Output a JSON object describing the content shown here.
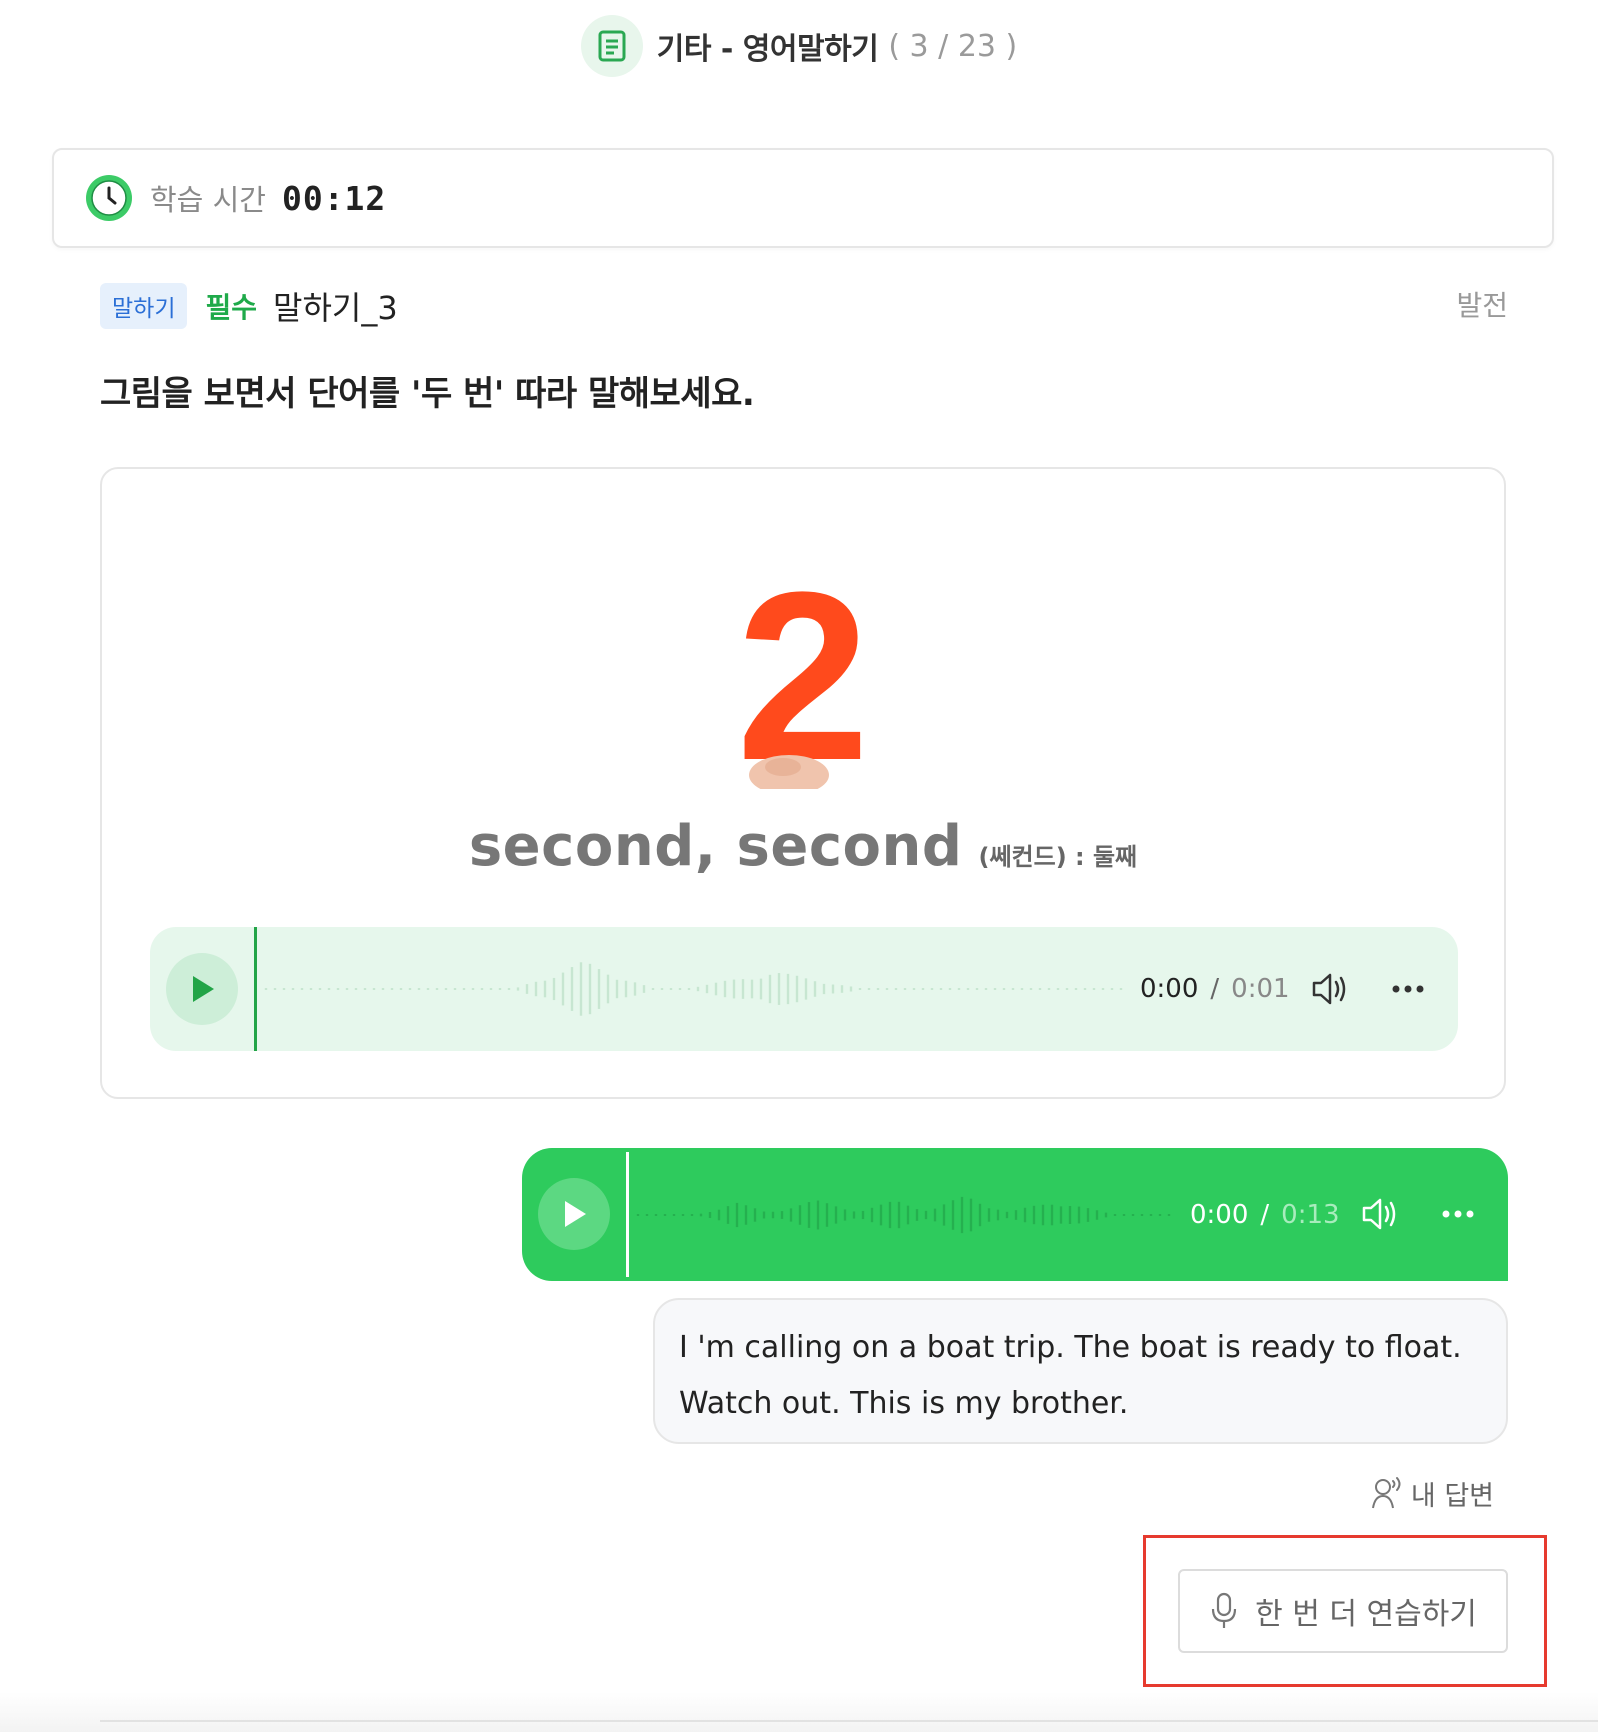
{
  "header": {
    "title": "기타 - 영어말하기",
    "count": "( 3 / 23 )",
    "icon": "document-icon"
  },
  "timer": {
    "label": "학습 시간",
    "value": "00:12",
    "icon": "clock-icon"
  },
  "question": {
    "tag": "말하기",
    "required": "필수",
    "name": "말하기_3",
    "level": "발전",
    "instruction": "그림을 보면서 단어를 '두 번' 따라 말해보세요."
  },
  "card": {
    "image_text": "2",
    "word": "second, second",
    "pronunciation": "(쎄컨드) : 둘째",
    "audio": {
      "current": "0:00",
      "separator": "/",
      "total": "0:01"
    }
  },
  "answer_audio": {
    "current": "0:00",
    "separator": "/",
    "total": "0:13"
  },
  "transcript": {
    "line1": "I 'm calling on a boat trip. The boat is ready to float.",
    "line2": "Watch out. This is my brother."
  },
  "my_answer_label": "내 답변",
  "practice_button": "한 번 더 연습하기",
  "colors": {
    "accent_green": "#2ecb5d",
    "light_green": "#e6f7ec",
    "number_orange": "#ff4a1c",
    "highlight_red": "#e63a2e",
    "tag_blue": "#2b6fd6"
  }
}
